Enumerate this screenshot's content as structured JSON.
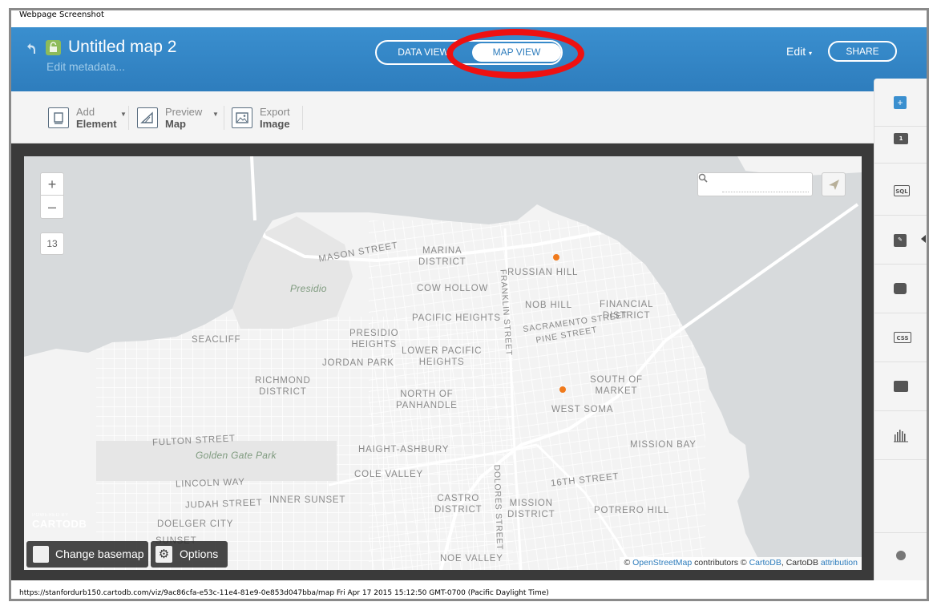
{
  "window": {
    "title": "Webpage Screenshot",
    "url_line": "https://stanfordurb150.cartodb.com/viz/9ac86cfa-e53c-11e4-81e9-0e853d047bba/map Fri Apr 17 2015 15:12:50 GMT-0700 (Pacific Daylight Time)"
  },
  "header": {
    "map_title": "Untitled map 2",
    "edit_metadata": "Edit metadata...",
    "tabs": [
      {
        "label": "DATA VIEW",
        "active": false
      },
      {
        "label": "MAP VIEW",
        "active": true
      }
    ],
    "edit_label": "Edit",
    "share_label": "SHARE",
    "highlight_color": "#ee1111"
  },
  "toolbar": {
    "add": {
      "line1": "Add",
      "line2": "Element"
    },
    "preview": {
      "line1": "Preview",
      "line2": "Map"
    },
    "export": {
      "line1": "Export",
      "line2": "Image"
    }
  },
  "map": {
    "zoom_in": "+",
    "zoom_out": "–",
    "zoom_level": "13",
    "search_placeholder": "",
    "powered_small": "POWERED BY",
    "powered_logo": "CARTODB",
    "change_basemap": "Change basemap",
    "options": "Options",
    "attribution": {
      "prefix": "© ",
      "osm": "OpenStreetMap",
      "mid": " contributors © ",
      "cartodb": "CartoDB",
      "mid2": ", CartoDB ",
      "attr": "attribution"
    },
    "labels": {
      "marina": "MARINA\nDISTRICT",
      "mason": "MASON STREET",
      "russian_hill": "RUSSIAN HILL",
      "cow_hollow": "COW HOLLOW",
      "presidio": "Presidio",
      "nob_hill": "NOB HILL",
      "financial": "FINANCIAL\nDISTRICT",
      "pacific_heights": "PACIFIC HEIGHTS",
      "sacramento": "SACRAMENTO STREET",
      "pine": "PINE STREET",
      "franklin": "FRANKLIN STREET",
      "seacliff": "SEACLIFF",
      "presidio_heights": "PRESIDIO\nHEIGHTS",
      "lower_pacific": "LOWER PACIFIC\nHEIGHTS",
      "jordan_park": "JORDAN PARK",
      "richmond": "RICHMOND\nDISTRICT",
      "south_of_market": "SOUTH OF\nMARKET",
      "north_panhandle": "NORTH OF\nPANHANDLE",
      "west_soma": "WEST SOMA",
      "fulton": "FULTON STREET",
      "golden_gate_park": "Golden Gate Park",
      "mission_bay": "MISSION BAY",
      "haight": "HAIGHT-ASHBURY",
      "cole_valley": "COLE VALLEY",
      "lincoln": "LINCOLN WAY",
      "sixteenth": "16TH STREET",
      "judah": "JUDAH STREET",
      "inner_sunset": "INNER SUNSET",
      "castro": "CASTRO\nDISTRICT",
      "mission": "MISSION\nDISTRICT",
      "potrero": "POTRERO HILL",
      "dolores": "DOLORES STREET",
      "doelger": "DOELGER CITY",
      "sunset": "SUNSET",
      "noe_valley": "NOE VALLEY"
    },
    "point_color": "#f07a1c",
    "water_color": "#d7dadc",
    "land_color": "#f3f3f3",
    "park_color": "#e6e6e6"
  },
  "sidebar": {
    "items": [
      {
        "icon": "plus-icon",
        "label": "+"
      },
      {
        "icon": "layer-icon",
        "label": "1"
      },
      {
        "icon": "sql-icon",
        "label": "SQL"
      },
      {
        "icon": "wizard-icon",
        "label": ""
      },
      {
        "icon": "infowindow-icon",
        "label": ""
      },
      {
        "icon": "css-icon",
        "label": "CSS"
      },
      {
        "icon": "legend-icon",
        "label": ""
      },
      {
        "icon": "filter-icon",
        "label": ""
      },
      {
        "icon": "merge-icon",
        "label": ""
      }
    ]
  }
}
